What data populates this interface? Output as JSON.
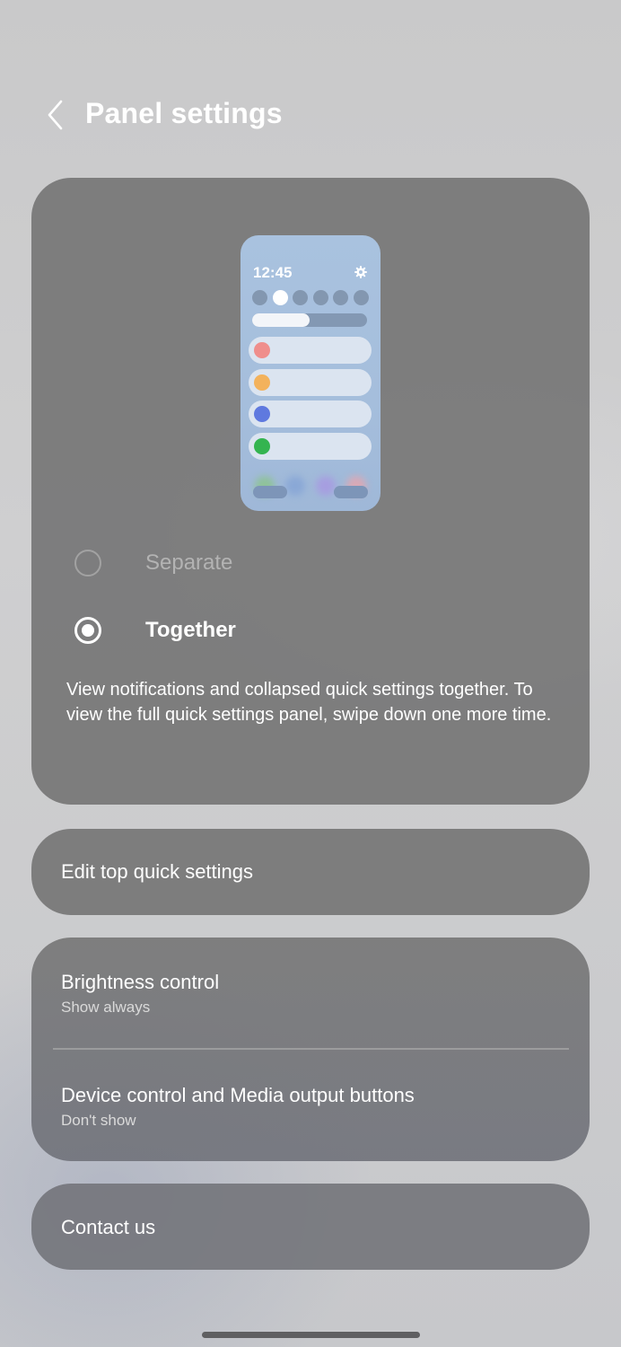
{
  "header": {
    "title": "Panel settings",
    "back_icon": "chevron-left-icon"
  },
  "panel_preview": {
    "time": "12:45",
    "gear_icon": "gear-icon",
    "qs_dot_count": 6,
    "active_qs_dot": 1,
    "brightness_level": 0.5,
    "notification_colors": [
      "#ef8e8c",
      "#f3b25c",
      "#5f79df",
      "#34b450"
    ]
  },
  "options": {
    "separate_label": "Separate",
    "together_label": "Together",
    "selected": "Together"
  },
  "panel_description": "View notifications and collapsed quick settings together. To view the full quick settings panel, swipe down one more time.",
  "edit_top": {
    "label": "Edit top quick settings"
  },
  "brightness": {
    "title": "Brightness control",
    "value": "Show always"
  },
  "device_control": {
    "title": "Device control and Media output buttons",
    "value": "Don't show"
  },
  "contact": {
    "label": "Contact us"
  }
}
